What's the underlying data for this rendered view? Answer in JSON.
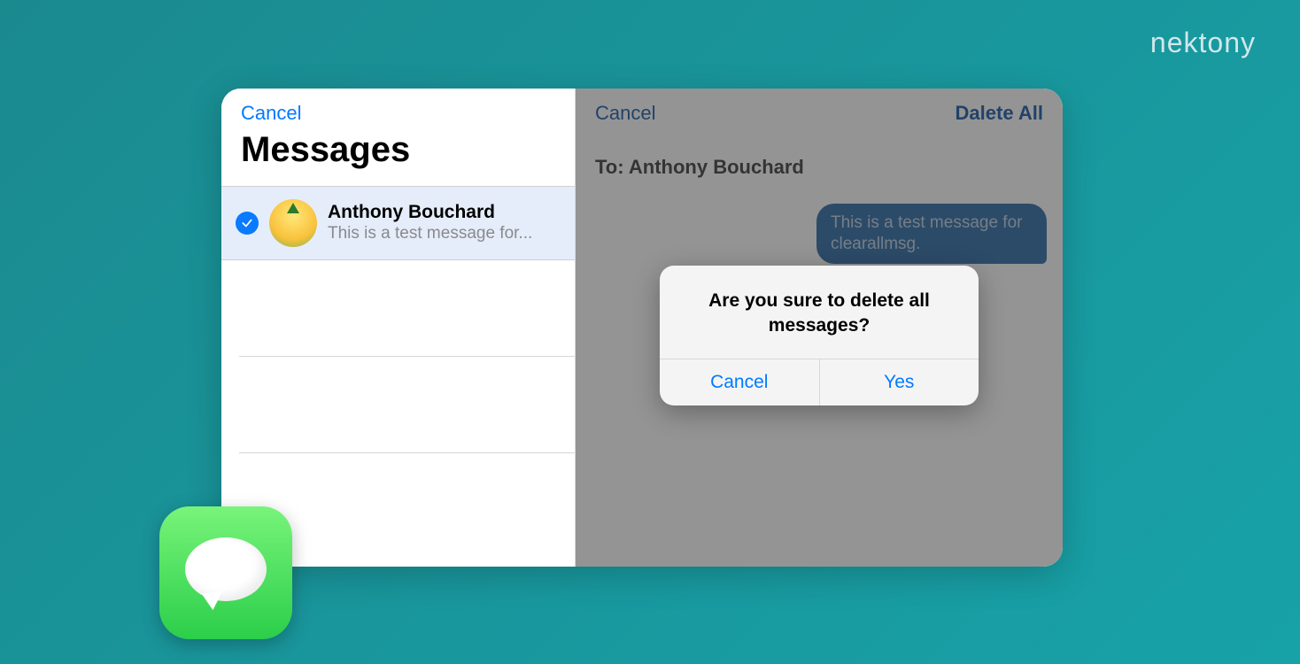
{
  "brand": "nektony",
  "left": {
    "cancel": "Cancel",
    "title": "Messages",
    "conversation": {
      "name": "Anthony Bouchard",
      "preview": "This is a test message for..."
    }
  },
  "right": {
    "cancel": "Cancel",
    "delete_all": "Dalete All",
    "to_prefix": "To:",
    "to_name": "Anthony Bouchard",
    "bubble": "This is a test message for clearallmsg."
  },
  "alert": {
    "message": "Are you sure to delete all messages?",
    "cancel": "Cancel",
    "yes": "Yes"
  }
}
